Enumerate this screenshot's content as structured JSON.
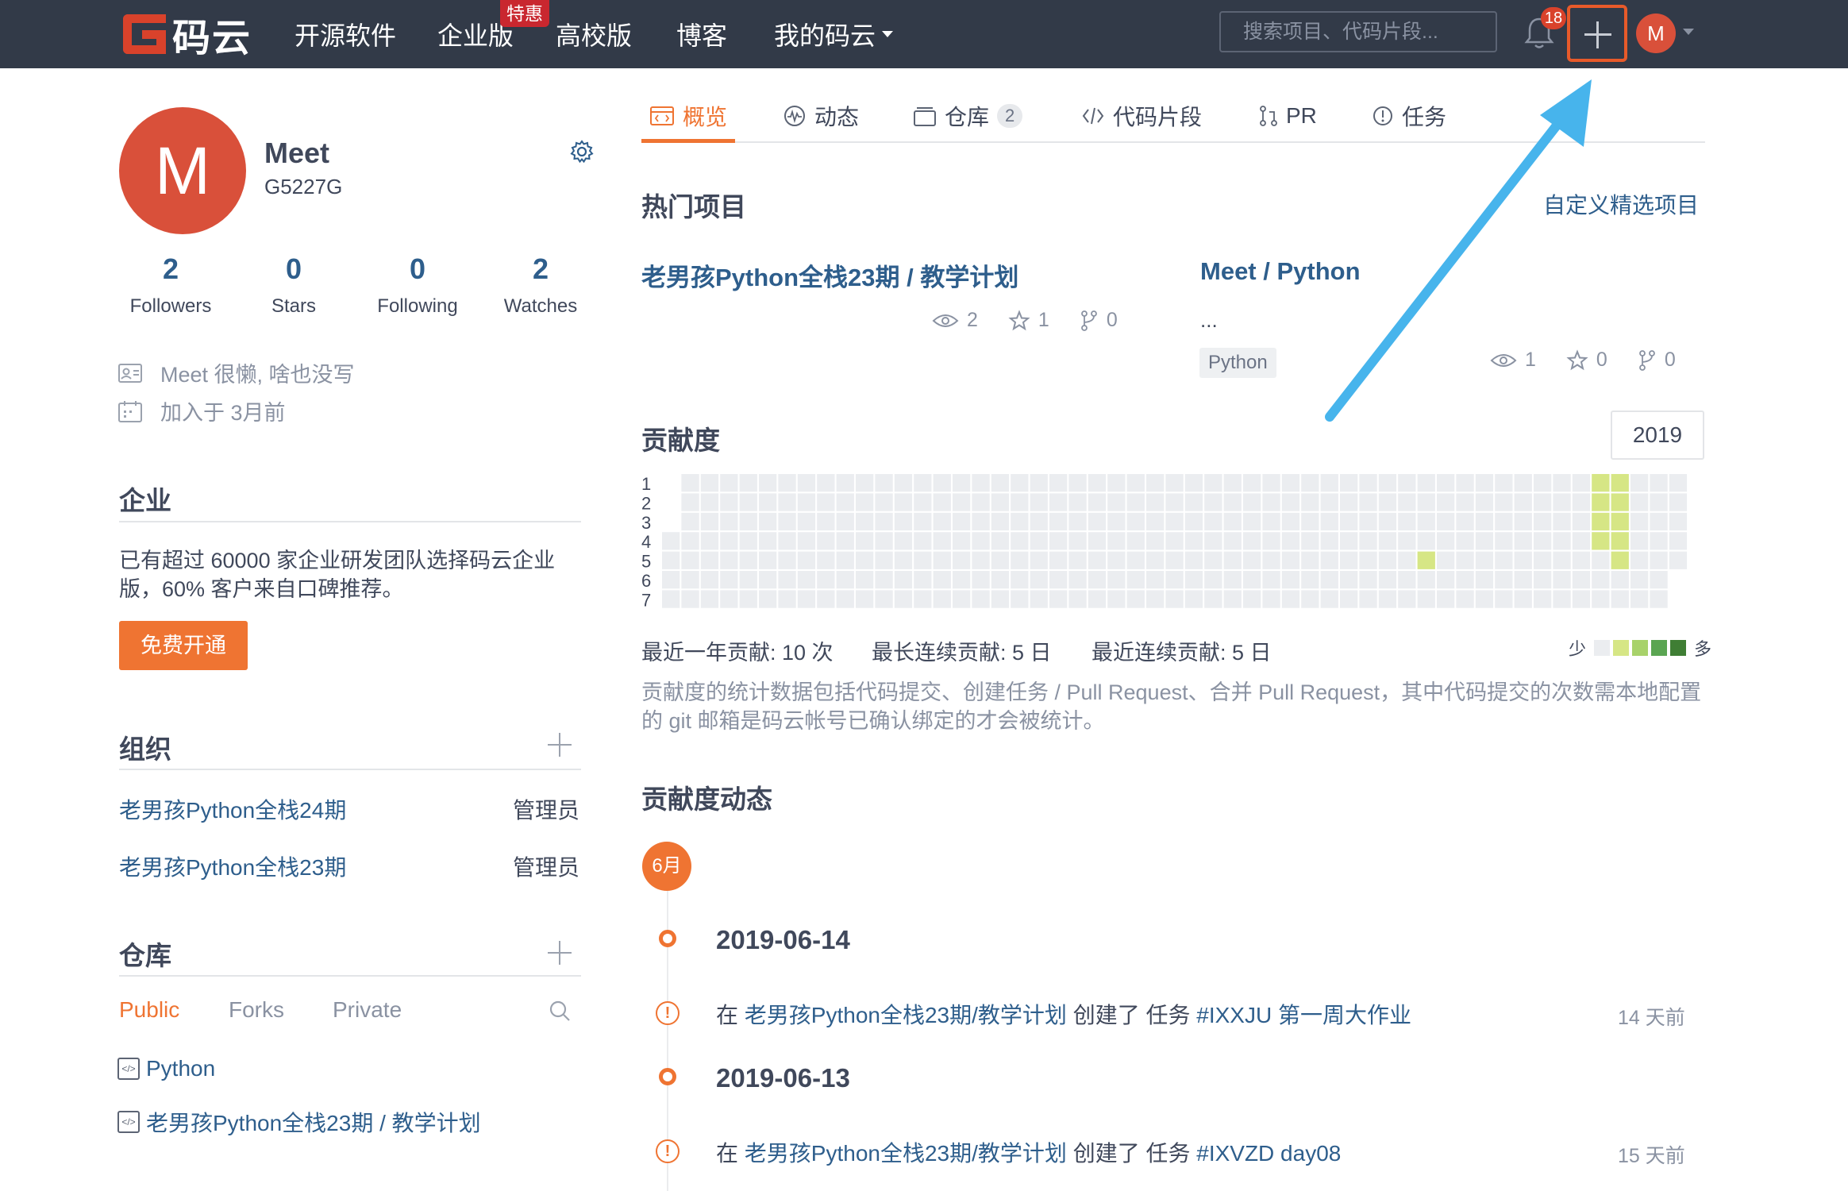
{
  "header": {
    "logo_text": "码云",
    "nav": [
      "开源软件",
      "企业版",
      "高校版",
      "博客",
      "我的码云"
    ],
    "promo_badge": "特惠",
    "search_placeholder": "搜索项目、代码片段...",
    "notification_count": "18",
    "avatar_letter": "M"
  },
  "profile": {
    "avatar_letter": "M",
    "name": "Meet",
    "id": "G5227G",
    "stats": [
      {
        "value": "2",
        "label": "Followers"
      },
      {
        "value": "0",
        "label": "Stars"
      },
      {
        "value": "0",
        "label": "Following"
      },
      {
        "value": "2",
        "label": "Watches"
      }
    ],
    "bio": "Meet 很懒, 啥也没写",
    "joined": "加入于 3月前"
  },
  "enterprise": {
    "title": "企业",
    "text": "已有超过 60000 家企业研发团队选择码云企业版，60% 客户来自口碑推荐。",
    "button": "免费开通"
  },
  "orgs": {
    "title": "组织",
    "items": [
      {
        "name": "老男孩Python全栈24期",
        "role": "管理员"
      },
      {
        "name": "老男孩Python全栈23期",
        "role": "管理员"
      }
    ]
  },
  "repos": {
    "title": "仓库",
    "tabs": [
      "Public",
      "Forks",
      "Private"
    ],
    "items": [
      "Python",
      "老男孩Python全栈23期 / 教学计划"
    ]
  },
  "tabs": {
    "items": [
      {
        "label": "概览",
        "icon": "overview-icon"
      },
      {
        "label": "动态",
        "icon": "activity-icon"
      },
      {
        "label": "仓库",
        "icon": "repo-icon",
        "count": "2"
      },
      {
        "label": "代码片段",
        "icon": "code-icon"
      },
      {
        "label": "PR",
        "icon": "pull-request-icon"
      },
      {
        "label": "任务",
        "icon": "issue-icon"
      }
    ]
  },
  "hot": {
    "title": "热门项目",
    "custom_link": "自定义精选项目",
    "projects": [
      {
        "title": "老男孩Python全栈23期 / 教学计划",
        "desc": "",
        "lang": "",
        "watch": "2",
        "star": "1",
        "fork": "0"
      },
      {
        "title": "Meet / Python",
        "desc": "...",
        "lang": "Python",
        "watch": "1",
        "star": "0",
        "fork": "0"
      }
    ]
  },
  "contrib": {
    "title": "贡献度",
    "year": "2019",
    "day_labels": [
      "1",
      "2",
      "3",
      "4",
      "5",
      "6",
      "7"
    ],
    "summary": [
      "最近一年贡献: 10 次",
      "最长连续贡献: 5 日",
      "最近连续贡献: 5 日"
    ],
    "legend_less": "少",
    "legend_more": "多",
    "levels": [
      "#ebedf0",
      "#d6e685",
      "#a8d26a",
      "#5aa552",
      "#3f7e34"
    ],
    "active": [
      [
        39,
        4
      ],
      [
        48,
        0
      ],
      [
        48,
        1
      ],
      [
        48,
        2
      ],
      [
        48,
        3
      ],
      [
        49,
        0
      ],
      [
        49,
        1
      ],
      [
        49,
        2
      ],
      [
        49,
        3
      ],
      [
        49,
        4
      ]
    ],
    "note": "贡献度的统计数据包括代码提交、创建任务 / Pull Request、合并 Pull Request，其中代码提交的次数需本地配置的 git 邮箱是码云帐号已确认绑定的才会被统计。"
  },
  "activity": {
    "title": "贡献度动态",
    "month": "6月",
    "entries": [
      {
        "date": "2019-06-14",
        "prefix": "在",
        "repo": "老男孩Python全栈23期/教学计划",
        "action": "创建了 任务",
        "issue": "#IXXJU 第一周大作业",
        "ago": "14 天前"
      },
      {
        "date": "2019-06-13",
        "prefix": "在",
        "repo": "老男孩Python全栈23期/教学计划",
        "action": "创建了 任务",
        "issue": "#IXVZD day08",
        "ago": "15 天前"
      }
    ]
  }
}
